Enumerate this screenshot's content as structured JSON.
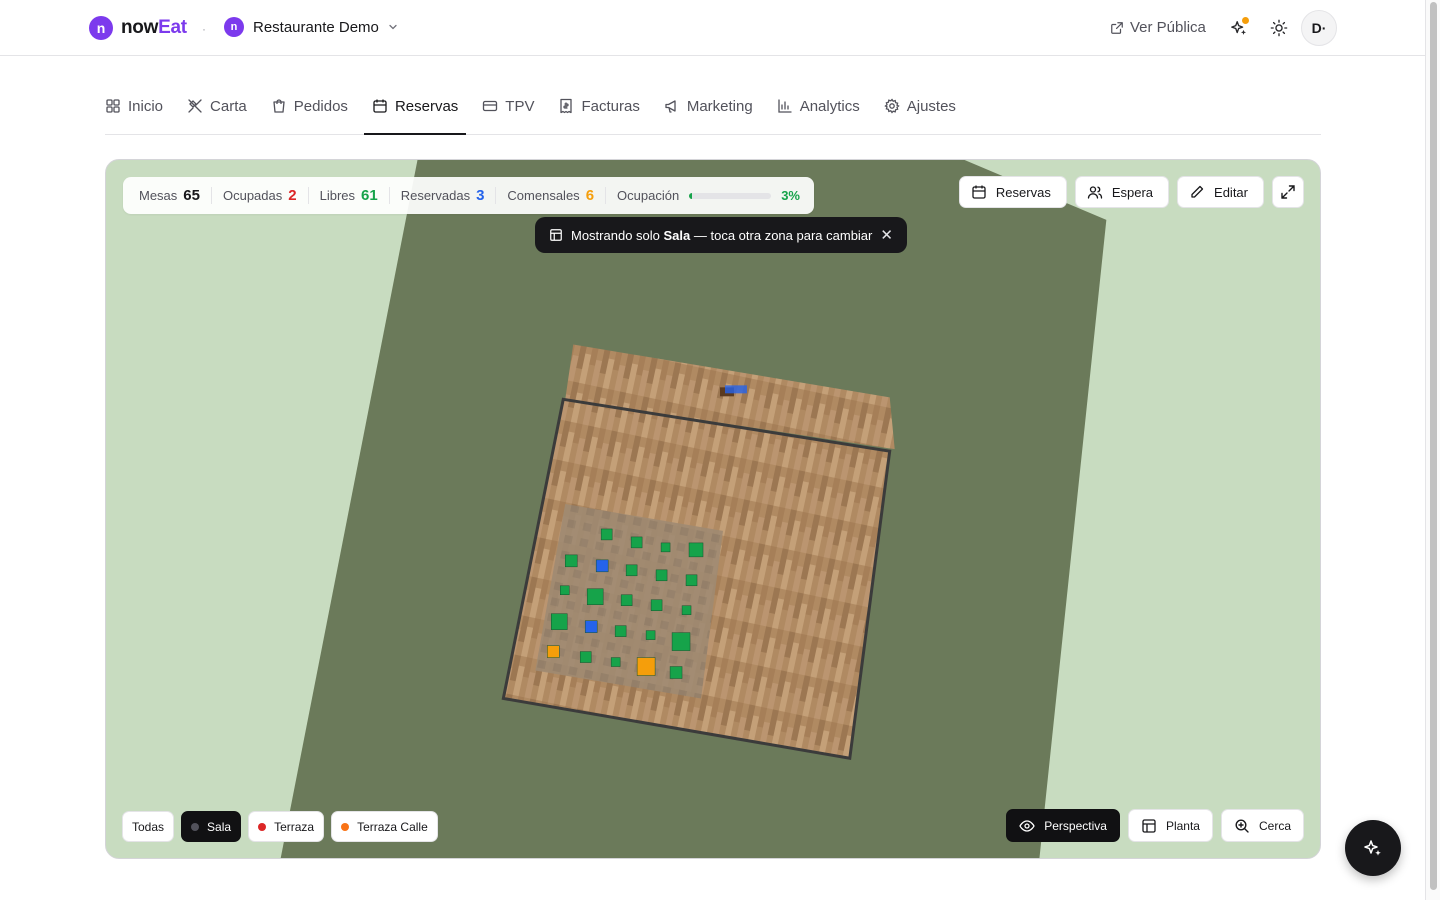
{
  "header": {
    "brand_initial": "n",
    "brand_name_a": "now",
    "brand_name_b": "Eat",
    "separator": "·",
    "restaurant_initial": "n",
    "restaurant_name": "Restaurante Demo",
    "public_link": "Ver Pública",
    "avatar": "D·"
  },
  "tabs": [
    {
      "label": "Inicio",
      "icon": "grid-icon"
    },
    {
      "label": "Carta",
      "icon": "utensils-icon"
    },
    {
      "label": "Pedidos",
      "icon": "shopping-bag-icon"
    },
    {
      "label": "Reservas",
      "icon": "calendar-icon",
      "active": true
    },
    {
      "label": "TPV",
      "icon": "credit-card-icon"
    },
    {
      "label": "Facturas",
      "icon": "receipt-icon"
    },
    {
      "label": "Marketing",
      "icon": "megaphone-icon"
    },
    {
      "label": "Analytics",
      "icon": "bar-chart-icon"
    },
    {
      "label": "Ajustes",
      "icon": "gear-icon"
    }
  ],
  "stats": {
    "mesas_label": "Mesas",
    "mesas": "65",
    "ocupadas_label": "Ocupadas",
    "ocupadas": "2",
    "libres_label": "Libres",
    "libres": "61",
    "reservadas_label": "Reservadas",
    "reservadas": "3",
    "comensales_label": "Comensales",
    "comensales": "6",
    "ocupacion_label": "Ocupación",
    "ocupacion": "3%",
    "ocupacion_fraction": 0.03
  },
  "colors": {
    "ocupadas": "#dc2626",
    "libres": "#16a34a",
    "reservadas": "#2563eb",
    "comensales": "#f59e0b",
    "accent": "#7c3aed"
  },
  "toast": {
    "prefix": "Mostrando solo",
    "zone": "Sala",
    "suffix": "— toca otra zona para cambiar"
  },
  "actions": {
    "reservas": "Reservas",
    "espera": "Espera",
    "editar": "Editar"
  },
  "zones": [
    {
      "label": "Todas",
      "dot": null
    },
    {
      "label": "Sala",
      "dot": "#52525b",
      "active": true
    },
    {
      "label": "Terraza",
      "dot": "#dc2626"
    },
    {
      "label": "Terraza Calle",
      "dot": "#f97316"
    }
  ],
  "views": {
    "perspectiva": "Perspectiva",
    "planta": "Planta",
    "cerca": "Cerca"
  }
}
